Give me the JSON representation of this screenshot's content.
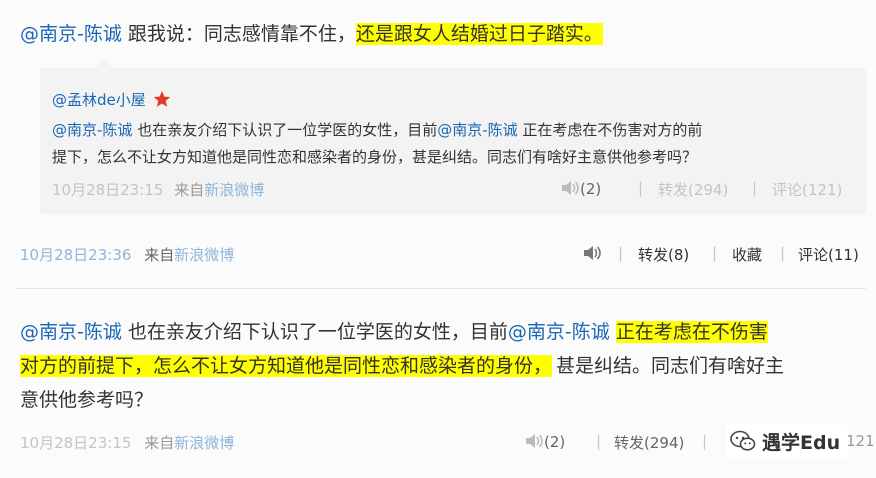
{
  "top_post": {
    "author": "@南京-陈诚",
    "text_before": " 跟我说：同志感情靠不住，",
    "text_highlight": "还是跟女人结婚过日子踏实。"
  },
  "quoted_post": {
    "author": "@孟林de小屋",
    "line1_author": "@南京-陈诚",
    "line1_mid": " 也在亲友介绍下认识了一位学医的女性，目前",
    "line1_mention": "@南京-陈诚",
    "line1_end": " 正在考虑在不伤害对方的前",
    "line2": "提下，怎么不让女方知道他是同性恋和感染者的身份，甚是纠结。同志们有啥好主意供他参考吗？",
    "timestamp": "10月28日23:15",
    "source_prefix": "来自",
    "source": "新浪微博",
    "voice_count": "(2)",
    "repost": "转发(294)",
    "comment": "评论(121)"
  },
  "top_post_meta": {
    "timestamp": "10月28日23:36",
    "source_prefix": "来自",
    "source": "新浪微博",
    "repost": "转发(8)",
    "favorite": "收藏",
    "comment": "评论(11)"
  },
  "second_post": {
    "author": "@南京-陈诚",
    "line1_mid": " 也在亲友介绍下认识了一位学医的女性，目前",
    "line1_mention": "@南京-陈诚",
    "line1_hl": "正在考虑在不伤害",
    "line2_hl": "对方的前提下，怎么不让女方知道他是同性恋和感染者的身份，",
    "line2_end": "甚是纠结。同志们有啥好主",
    "line3": "意供他参考吗？",
    "timestamp": "10月28日23:15",
    "source_prefix": "来自",
    "source": "新浪微博",
    "voice_count": "(2)",
    "repost": "转发(294)"
  },
  "watermark": {
    "text": "遇学Edu",
    "comment_partial": "121)"
  },
  "colors": {
    "link": "#1b67b4",
    "highlight": "#ffff00",
    "quote_bg": "#f3f3f3",
    "star": "#e23b2a"
  }
}
